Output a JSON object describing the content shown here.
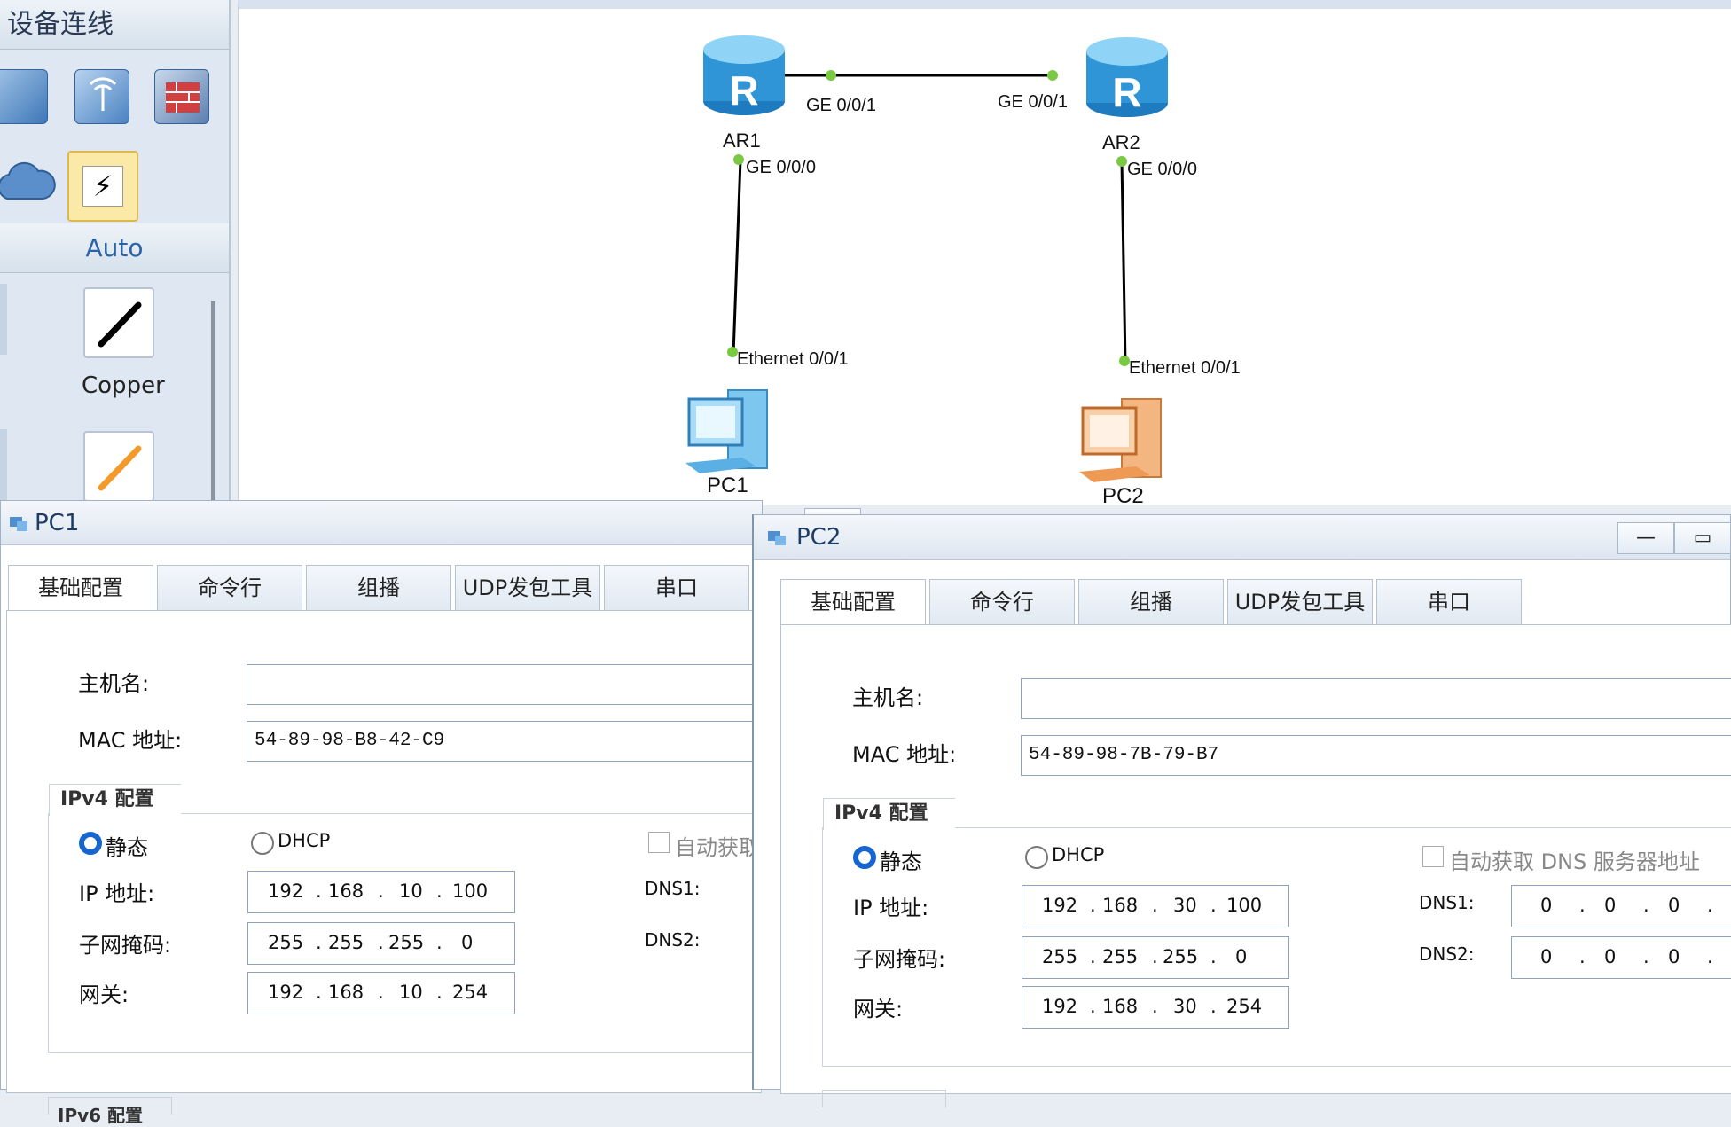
{
  "palette": {
    "header": "设备连线",
    "section": "Auto",
    "copper_label": "Copper",
    "icons": [
      "switch-icon",
      "wireless-ap-icon",
      "firewall-icon",
      "cloud-icon",
      "power-connector-icon"
    ]
  },
  "topology": {
    "devices": [
      {
        "name": "AR1"
      },
      {
        "name": "AR2"
      },
      {
        "name": "PC1"
      },
      {
        "name": "PC2"
      }
    ],
    "ports": {
      "ar1_ge001": "GE 0/0/1",
      "ar2_ge001": "GE 0/0/1",
      "ar1_ge000": "GE 0/0/0",
      "ar2_ge000": "GE 0/0/0",
      "pc1_eth": "Ethernet 0/0/1",
      "pc2_eth": "Ethernet 0/0/1"
    }
  },
  "tabs": [
    "基础配置",
    "命令行",
    "组播",
    "UDP发包工具",
    "串口"
  ],
  "labels": {
    "hostname": "主机名:",
    "mac": "MAC 地址:",
    "ipv4": "IPv4 配置",
    "ipv6": "IPv6 配置",
    "static": "静态",
    "dhcp": "DHCP",
    "auto_dns_pc1": "自动获取",
    "auto_dns_pc2": "自动获取 DNS 服务器地址",
    "ip": "IP 地址:",
    "mask": "子网掩码:",
    "gateway": "网关:",
    "dns1": "DNS1:",
    "dns2": "DNS2:"
  },
  "pc1": {
    "title": "PC1",
    "hostname": "",
    "mac": "54-89-98-B8-42-C9",
    "ip": [
      "192",
      "168",
      "10",
      "100"
    ],
    "mask": [
      "255",
      "255",
      "255",
      "0"
    ],
    "gateway": [
      "192",
      "168",
      "10",
      "254"
    ]
  },
  "pc2": {
    "title": "PC2",
    "hostname": "",
    "mac": "54-89-98-7B-79-B7",
    "ip": [
      "192",
      "168",
      "30",
      "100"
    ],
    "mask": [
      "255",
      "255",
      "255",
      "0"
    ],
    "gateway": [
      "192",
      "168",
      "30",
      "254"
    ],
    "dns1": [
      "0",
      "0",
      "0",
      ""
    ],
    "dns2": [
      "0",
      "0",
      "0",
      ""
    ]
  },
  "window_buttons": {
    "minimize": "—",
    "maximize": "▭"
  },
  "colors": {
    "link_dot": "#7ac943",
    "router": "#3aa0d8",
    "pc1": "#5fb6ea",
    "pc2": "#f0a060",
    "radio_on": "#1665d0"
  }
}
